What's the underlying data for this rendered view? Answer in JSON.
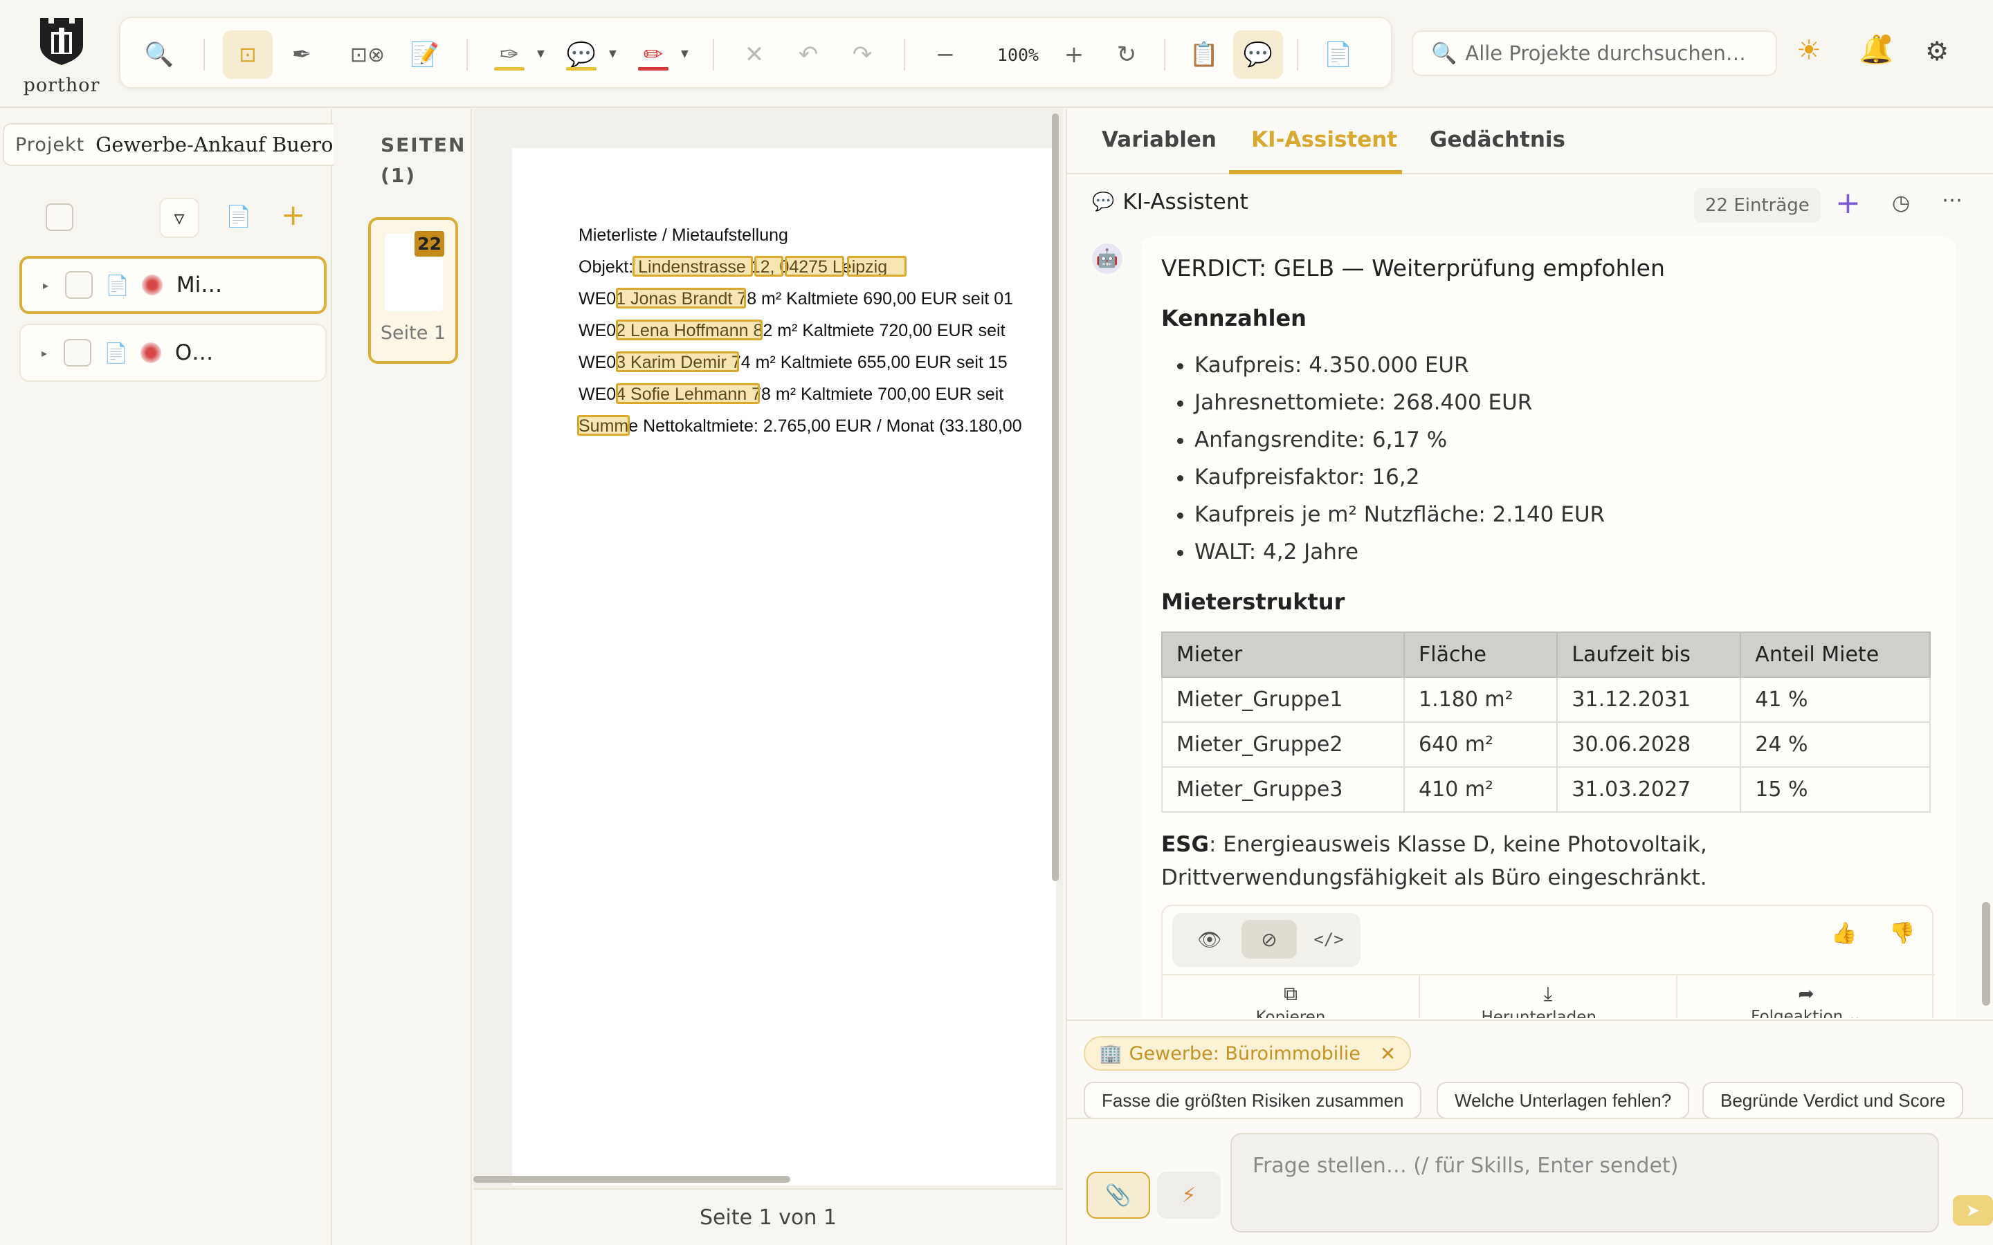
{
  "app": {
    "logo_text": "porthor"
  },
  "toolbar": {
    "zoom": "100%",
    "tools": [
      "search-icon",
      "select-box-icon",
      "pen-icon",
      "region-tool-icon",
      "document-edit-icon",
      "highlighter-icon",
      "comment-icon",
      "marker-icon",
      "clear-icon",
      "undo-icon",
      "redo-icon",
      "zoom-out-icon",
      "zoom-in-icon",
      "reset-icon",
      "clipboard-icon",
      "chat-icon",
      "page-icon"
    ],
    "colors": {
      "highlighter": "#e8c23c",
      "comment": "#e8c23c",
      "marker": "#d83a3a"
    }
  },
  "search": {
    "placeholder": "Alle Projekte durchsuchen…"
  },
  "sidebar": {
    "project_label": "Projekt",
    "project_name": "Gewerbe-Ankauf Buerohaus",
    "documents": [
      {
        "name": "Mi…",
        "selected": true
      },
      {
        "name": "O…",
        "selected": false
      }
    ]
  },
  "pages": {
    "title": "SEITEN (1)",
    "thumbs": [
      {
        "label": "Seite 1",
        "badge": "22"
      }
    ]
  },
  "document": {
    "lines": [
      "Mieterliste / Mietaufstellung",
      "Objekt: Lindenstrasse 12, 04275 Leipzig",
      "WE01  Jonas Brandt  78 m²  Kaltmiete 690,00 EUR  seit 01",
      "WE02  Lena Hoffmann  82 m²  Kaltmiete 720,00 EUR  seit",
      "WE03  Karim Demir  74 m²  Kaltmiete 655,00 EUR  seit 15",
      "WE04  Sofie Lehmann  78 m²  Kaltmiete 700,00 EUR  seit",
      "Summe Nettokaltmiete: 2.765,00 EUR / Monat  (33.180,00"
    ],
    "footer": "Seite 1 von 1"
  },
  "panel": {
    "tabs": [
      "Variablen",
      "KI-Assistent",
      "Gedächtnis"
    ],
    "active_tab": "KI-Assistent",
    "title": "KI-Assistent",
    "count": "22 Einträge",
    "message": {
      "verdict": "VERDICT: GELB — Weiterprüfung empfohlen",
      "kennzahlen_title": "Kennzahlen",
      "kennzahlen": [
        "Kaufpreis: 4.350.000 EUR",
        "Jahresnettomiete: 268.400 EUR",
        "Anfangsrendite: 6,17 %",
        "Kaufpreisfaktor: 16,2",
        "Kaufpreis je m² Nutzfläche: 2.140 EUR",
        "WALT: 4,2 Jahre"
      ],
      "mieter_title": "Mieterstruktur",
      "table": {
        "headers": [
          "Mieter",
          "Fläche",
          "Laufzeit bis",
          "Anteil Miete"
        ],
        "rows": [
          [
            "Mieter_Gruppe1",
            "1.180 m²",
            "31.12.2031",
            "41 %"
          ],
          [
            "Mieter_Gruppe2",
            "640 m²",
            "30.06.2028",
            "24 %"
          ],
          [
            "Mieter_Gruppe3",
            "410 m²",
            "31.03.2027",
            "15 %"
          ]
        ]
      },
      "esg_label": "ESG",
      "esg_text": ": Energieausweis Klasse D, keine Photovoltaik, Drittverwendungsfähigkeit als Büro eingeschränkt."
    },
    "actions": {
      "copy": "Kopieren",
      "download": "Herunterladen",
      "followup": "Folgeaktion"
    },
    "context_chip": "Gewerbe: Büroimmobilie",
    "suggestions": [
      "Fasse die größten Risiken zusammen",
      "Welche Unterlagen fehlen?",
      "Begründe Verdict und Score"
    ],
    "input_placeholder": "Frage stellen… (/ für Skills, Enter sendet)"
  },
  "accent_color": "#d9a82f"
}
